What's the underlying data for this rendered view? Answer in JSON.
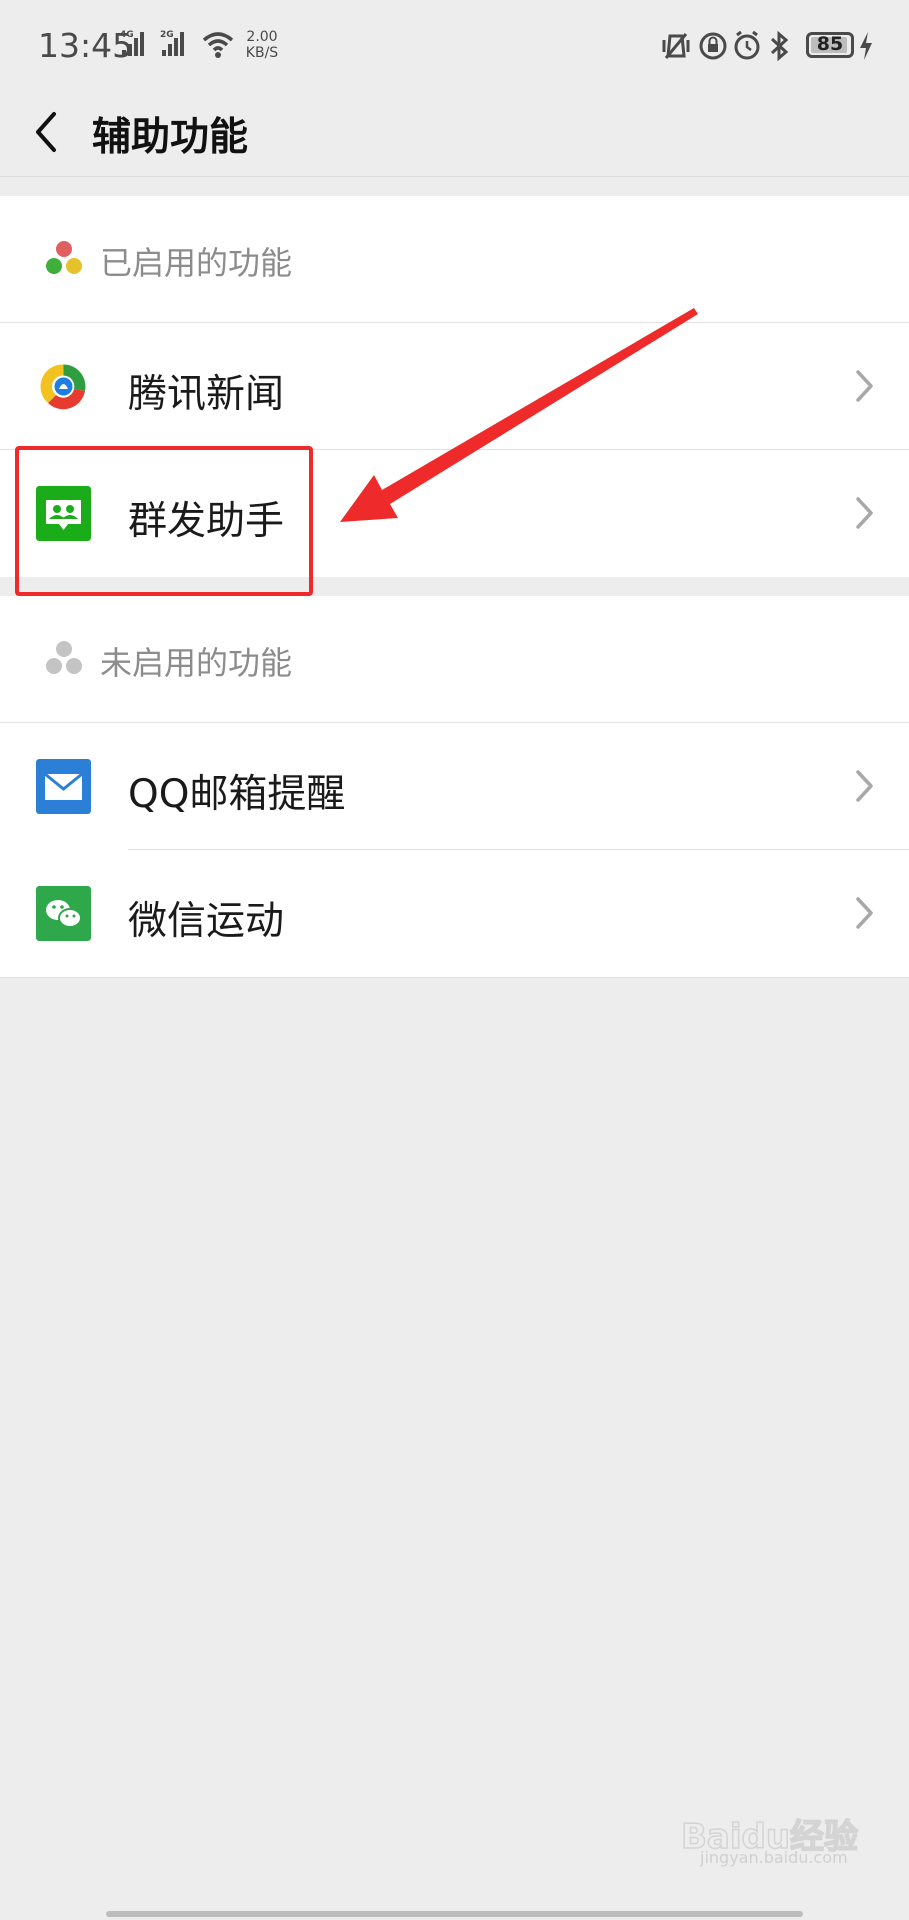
{
  "status_bar": {
    "time": "13:45",
    "net_4g": "4G",
    "net_2g": "2G",
    "speed_value": "2.00",
    "speed_unit": "KB/S",
    "battery": "85",
    "battery_level_percent": 85
  },
  "nav": {
    "title": "辅助功能",
    "back_icon": "chevron-left-icon"
  },
  "enabled_section": {
    "header": "已启用的功能",
    "items": [
      {
        "label": "腾讯新闻",
        "icon": "tencent-news-icon"
      },
      {
        "label": "群发助手",
        "icon": "group-message-icon"
      }
    ]
  },
  "disabled_section": {
    "header": "未启用的功能",
    "items": [
      {
        "label": "QQ邮箱提醒",
        "icon": "qq-mail-icon"
      },
      {
        "label": "微信运动",
        "icon": "wechat-sport-icon"
      }
    ]
  },
  "watermark": {
    "brand": "Baidu经验",
    "domain": "jingyan.baidu.com"
  },
  "colors": {
    "background": "#ededed",
    "highlight_red": "#ee2a2a",
    "wechat_green": "#1aad19",
    "mail_blue": "#2b7fd6"
  }
}
